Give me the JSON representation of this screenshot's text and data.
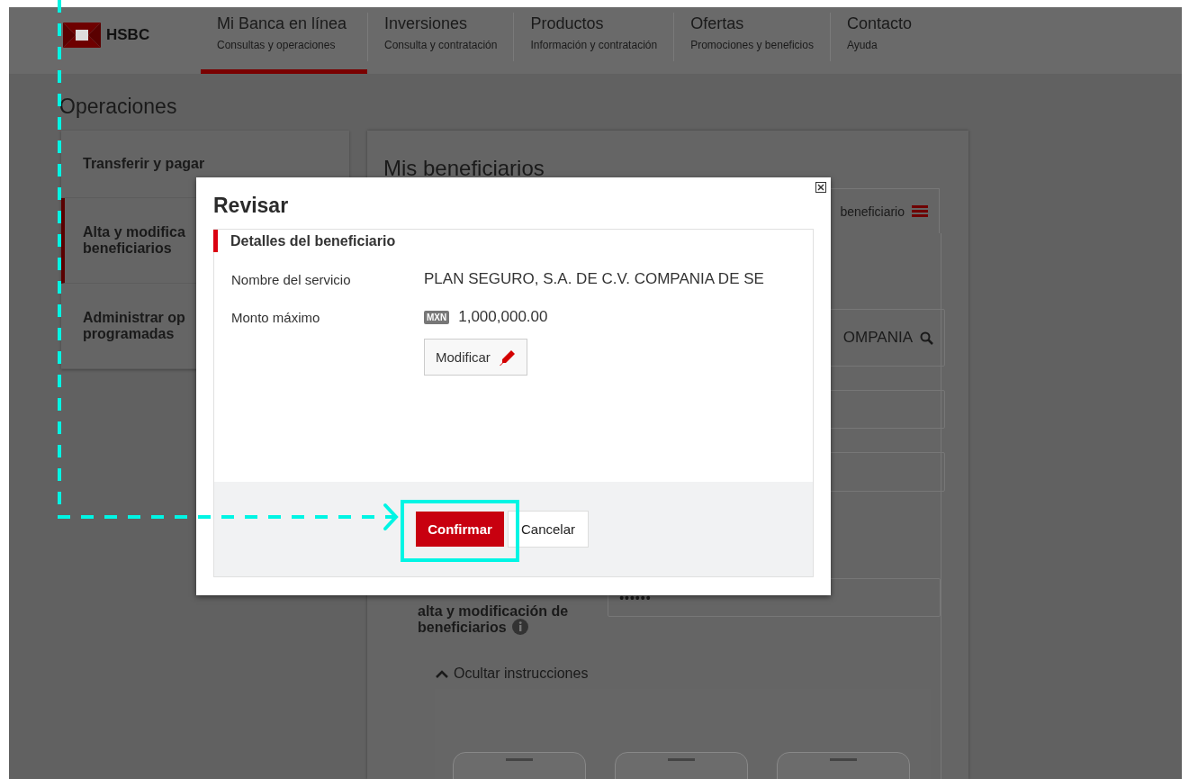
{
  "header": {
    "logo": "HSBC",
    "nav": [
      {
        "title": "Mi Banca en línea",
        "subtitle": "Consultas y operaciones",
        "selected": true
      },
      {
        "title": "Inversiones",
        "subtitle": "Consulta y contratación",
        "selected": false
      },
      {
        "title": "Productos",
        "subtitle": "Información y contratación",
        "selected": false
      },
      {
        "title": "Ofertas",
        "subtitle": "Promociones y beneficios",
        "selected": false
      },
      {
        "title": "Contacto",
        "subtitle": "Ayuda",
        "selected": false
      }
    ]
  },
  "page_title": "Operaciones",
  "sidebar": {
    "items": [
      {
        "lines": [
          "Transferir y pagar"
        ],
        "selected": false
      },
      {
        "lines": [
          "Alta y modifica",
          "beneficiarios"
        ],
        "selected": true
      },
      {
        "lines": [
          "Administrar op",
          "programadas"
        ],
        "selected": false
      }
    ]
  },
  "main": {
    "title": "Mis beneficiarios",
    "tab": "beneficiario",
    "search_value": "OMPANIA",
    "token_label": [
      "alta y modificación de",
      "beneficiarios"
    ],
    "token_value": "••••••",
    "instructions_toggle": "Ocultar instrucciones"
  },
  "modal": {
    "title": "Revisar",
    "section": "Detalles del beneficiario",
    "fields": [
      {
        "label": "Nombre del servicio",
        "value": "PLAN SEGURO, S.A. DE C.V. COMPANIA DE SE"
      },
      {
        "label": "Monto máximo",
        "currency": "MXN",
        "value": "1,000,000.00"
      }
    ],
    "modify_button": "Modificar",
    "confirm_button": "Confirmar",
    "cancel_button": "Cancelar"
  }
}
